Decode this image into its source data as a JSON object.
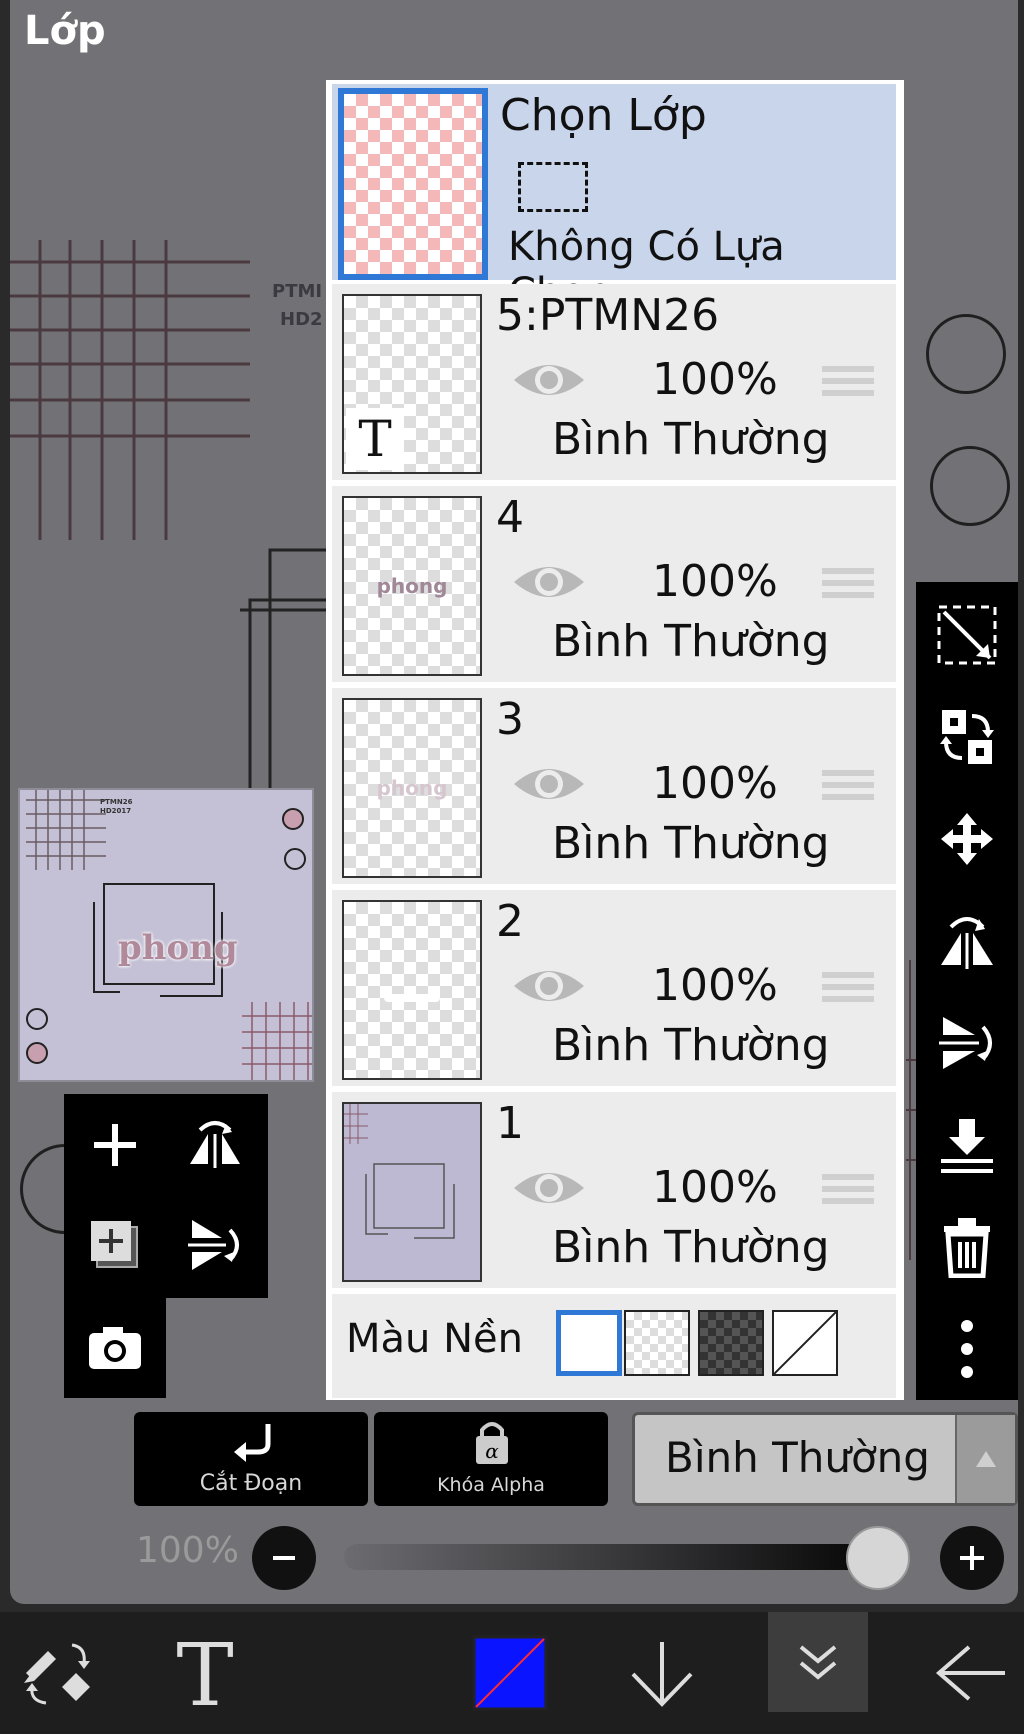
{
  "panel": {
    "title": "Lớp"
  },
  "canvas_bg": {
    "text_line1": "PTMI",
    "text_line2": "HD2"
  },
  "preview": {
    "logo_text": "phong",
    "tag_line1": "PTMN26",
    "tag_line2": "HD2017"
  },
  "selection_layer": {
    "title": "Chọn Lớp",
    "subtitle": "Không Có Lựa Chọn"
  },
  "layers": [
    {
      "name": "5:PTMN26",
      "opacity": "100%",
      "blend": "Bình Thường",
      "thumb_text": ""
    },
    {
      "name": "4",
      "opacity": "100%",
      "blend": "Bình Thường",
      "thumb_text": "phong"
    },
    {
      "name": "3",
      "opacity": "100%",
      "blend": "Bình Thường",
      "thumb_text": "phong"
    },
    {
      "name": "2",
      "opacity": "100%",
      "blend": "Bình Thường",
      "thumb_text": ""
    },
    {
      "name": "1",
      "opacity": "100%",
      "blend": "Bình Thường",
      "thumb_text": ""
    }
  ],
  "background": {
    "label": "Màu Nền"
  },
  "controls": {
    "clip_label": "Cắt Đoạn",
    "alpha_lock_label": "Khóa Alpha",
    "blend_mode": "Bình Thường",
    "opacity_value": "100%",
    "opacity_fraction": 1.0
  },
  "colors": {
    "accent": "#2f78d6",
    "current_color": "#0a14ff",
    "selected_row": "#c8d5ea"
  },
  "icons": {
    "left_tools": [
      "plus-icon",
      "flip-horizontal-icon",
      "add-layer-icon",
      "flip-vertical-icon",
      "camera-icon"
    ],
    "right_tools": [
      "select-diagonal-icon",
      "swap-layer-icon",
      "move-icon",
      "flip-h-icon",
      "flip-v-icon",
      "merge-down-icon",
      "trash-icon",
      "more-icon"
    ],
    "bottom_nav": [
      "tool-swap-icon",
      "text-tool-icon",
      "color-swatch",
      "arrow-down-icon",
      "collapse-icon",
      "back-arrow-icon"
    ]
  }
}
